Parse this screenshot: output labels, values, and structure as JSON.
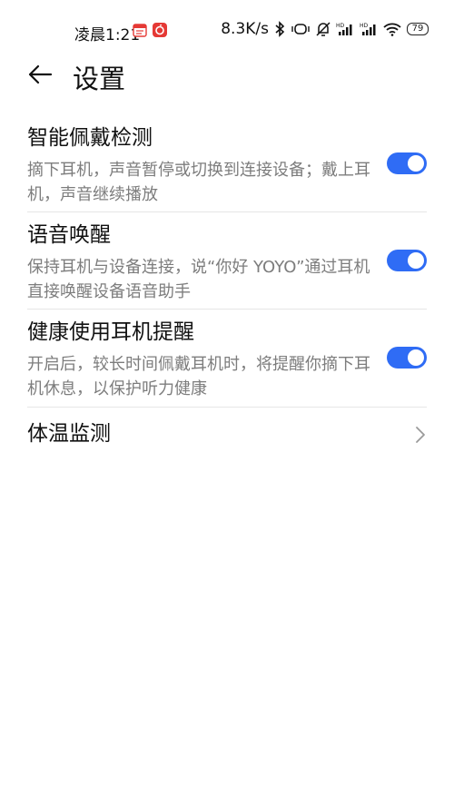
{
  "status_bar": {
    "time": "凌晨1:21",
    "net_speed": "8.3K/s",
    "battery": "79",
    "icons": [
      "calendar-notification-icon",
      "netease-music-icon",
      "bluetooth-icon",
      "vibrate-icon",
      "mute-bell-icon",
      "hd-signal-icon",
      "hd-signal-icon",
      "wifi-icon",
      "battery-icon"
    ]
  },
  "header": {
    "title": "设置"
  },
  "settings": [
    {
      "title": "智能佩戴检测",
      "desc": "摘下耳机，声音暂停或切换到连接设备；戴上耳机，声音继续播放",
      "enabled": true
    },
    {
      "title": "语音唤醒",
      "desc": "保持耳机与设备连接，说“你好 YOYO”通过耳机直接唤醒设备语音助手",
      "enabled": true
    },
    {
      "title": "健康使用耳机提醒",
      "desc": "开启后，较长时间佩戴耳机时，将提醒你摘下耳机休息，以保护听力健康",
      "enabled": true
    },
    {
      "title": "体温监测"
    }
  ],
  "colors": {
    "accent": "#2f6cf5",
    "notif_red": "#e53935"
  }
}
